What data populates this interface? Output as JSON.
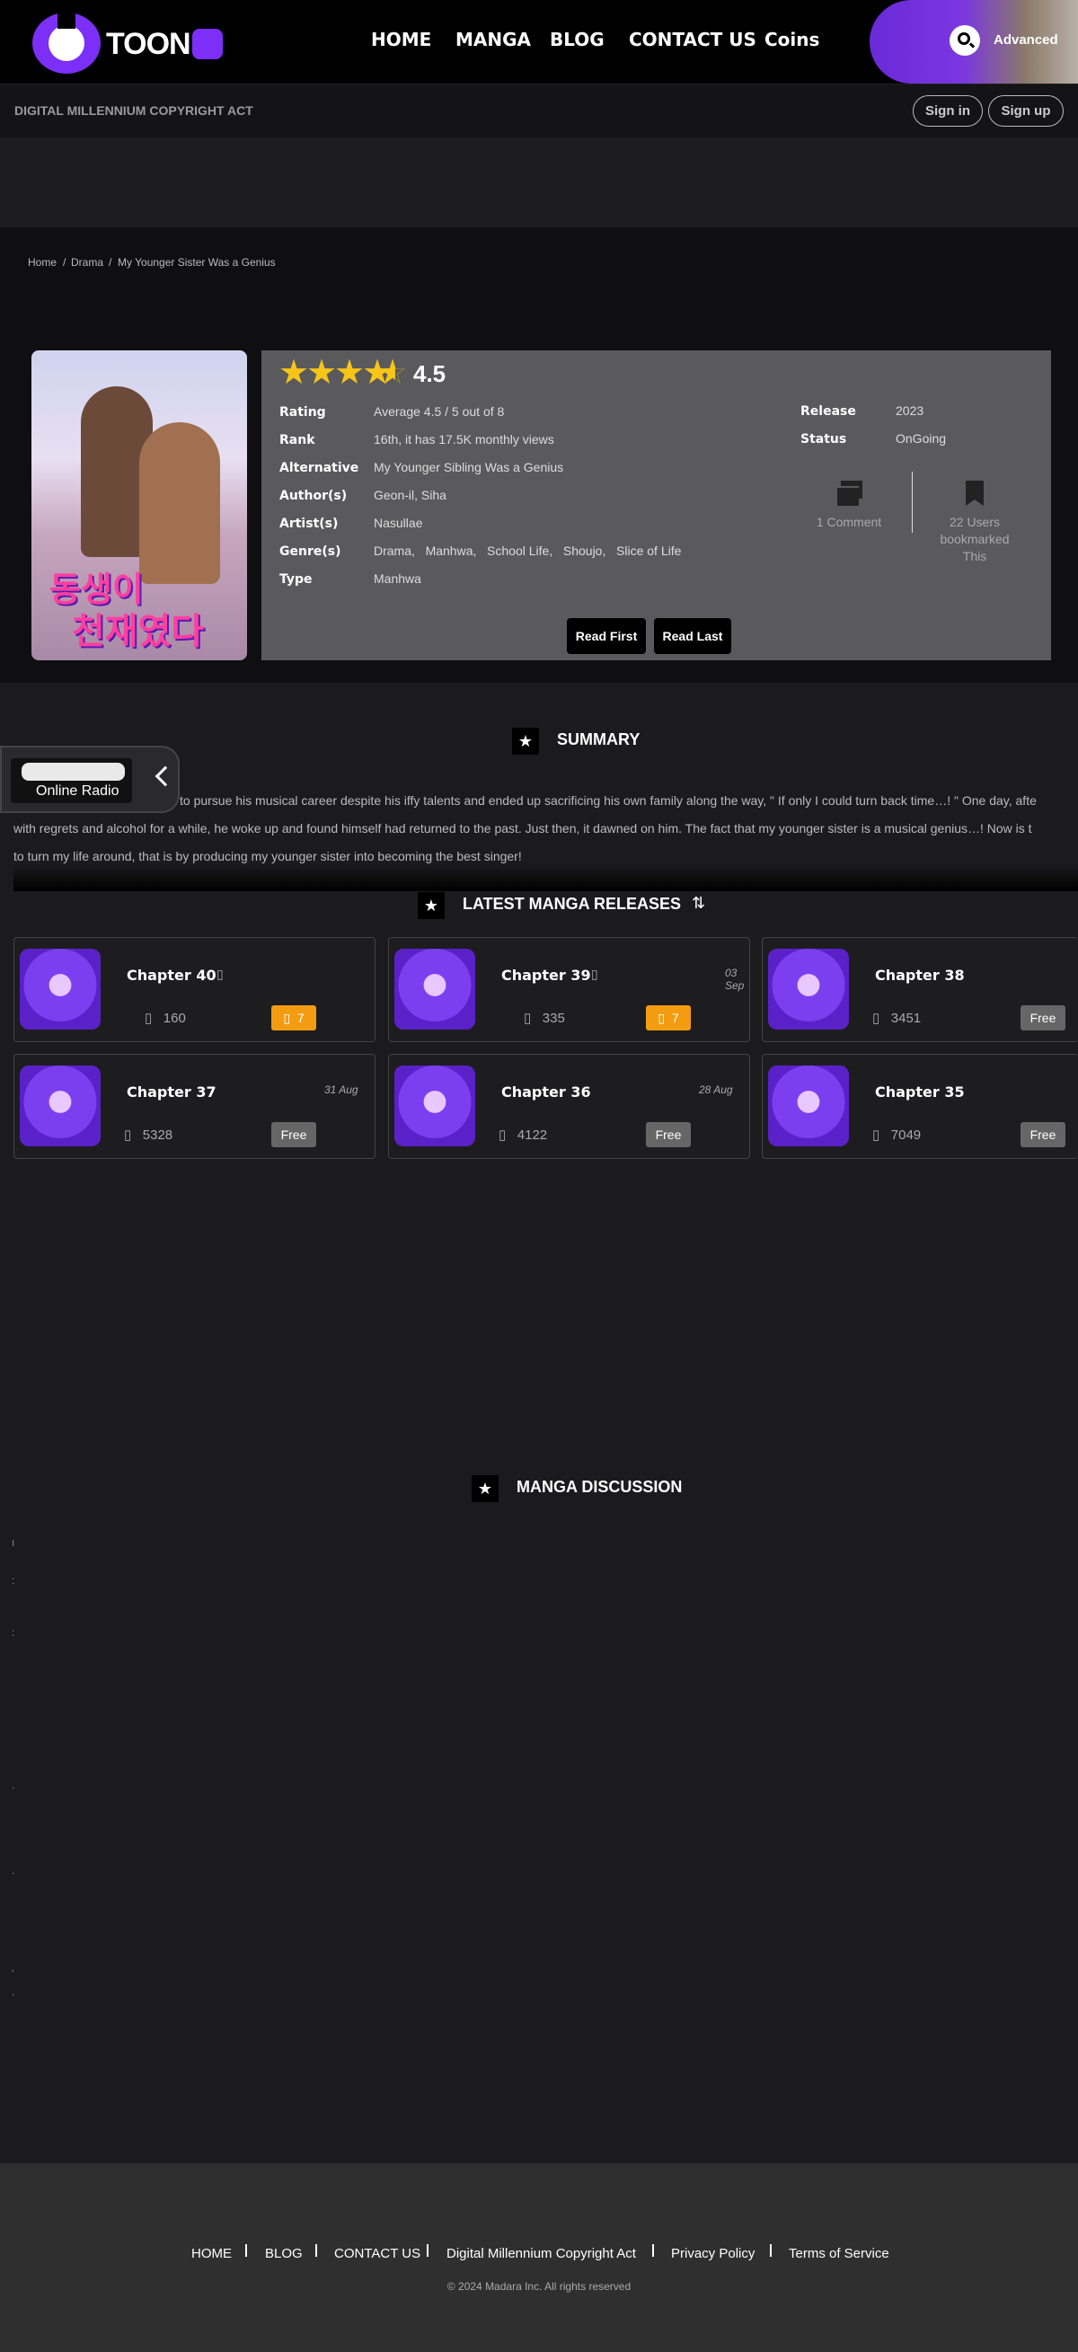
{
  "header": {
    "logo_text": "TOON",
    "nav": [
      "HOME",
      "MANGA",
      "BLOG",
      "CONTACT US",
      "Coins"
    ],
    "advanced_label": "Advanced"
  },
  "subheader": {
    "dmca": "DIGITAL MILLENNIUM COPYRIGHT ACT",
    "sign_in": "Sign in",
    "sign_up": "Sign up"
  },
  "breadcrumb": [
    "Home",
    "Drama",
    "My Younger Sister Was a Genius"
  ],
  "cover": {
    "title_line1": "동생이",
    "title_line2": "천재였다"
  },
  "manga": {
    "score": "4.5",
    "rows": [
      {
        "label": "Rating",
        "value": "Average 4.5 / 5 out of 8"
      },
      {
        "label": "Rank",
        "value": "16th, it has 17.5K monthly views"
      },
      {
        "label": "Alternative",
        "value": "My Younger Sibling Was a Genius"
      },
      {
        "label": "Author(s)",
        "value": "Geon-il,  Siha"
      },
      {
        "label": "Artist(s)",
        "value": "Nasullae"
      },
      {
        "label": "Genre(s)",
        "value": "Drama,   Manhwa,   School Life,   Shoujo,   Slice of Life"
      },
      {
        "label": "Type",
        "value": "Manhwa"
      }
    ],
    "release_label": "Release",
    "release_value": "2023",
    "status_label": "Status",
    "status_value": "OnGoing",
    "comments": "1 Comment",
    "bookmarks_line1": "22 Users",
    "bookmarks_line2": "bookmarked",
    "bookmarks_line3": "This",
    "read_first": "Read First",
    "read_last": "Read Last"
  },
  "summary": {
    "title": "SUMMARY",
    "line1": "to pursue his musical career despite his iffy talents and ended up sacrificing his own family along the way, \" If only I could turn back time…! \" One day, afte",
    "line2": "with regrets and alcohol for a while, he woke up and found himself had returned to the past. Just then, it dawned on him. The fact that my younger sister is a musical genius…! Now is t",
    "line3": "to turn my life around, that is by producing my younger sister into becoming the best singer!"
  },
  "radio": {
    "label": "Online Radio"
  },
  "releases": {
    "title": "LATEST MANGA RELEASES",
    "chapters": [
      {
        "name": "Chapter 40",
        "date": "",
        "views": "160",
        "badge": "7",
        "paid": true
      },
      {
        "name": "Chapter 39",
        "date": "03 Sep",
        "views": "335",
        "badge": "7",
        "paid": true
      },
      {
        "name": "Chapter 38",
        "date": "",
        "views": "3451",
        "badge": "Free",
        "paid": false
      },
      {
        "name": "Chapter 37",
        "date": "31 Aug",
        "views": "5328",
        "badge": "Free",
        "paid": false
      },
      {
        "name": "Chapter 36",
        "date": "28 Aug",
        "views": "4122",
        "badge": "Free",
        "paid": false
      },
      {
        "name": "Chapter 35",
        "date": "",
        "views": "7049",
        "badge": "Free",
        "paid": false
      }
    ]
  },
  "discussion": {
    "title": "MANGA DISCUSSION"
  },
  "footer": {
    "links": [
      "HOME",
      "BLOG",
      "CONTACT US",
      "Digital Millennium Copyright Act",
      "Privacy Policy",
      "Terms of Service"
    ],
    "copyright": "© 2024 Madara Inc. All rights reserved"
  },
  "colors": {
    "accent": "#7b2ff7",
    "coin_badge": "#f39c12",
    "star": "#f5c518"
  }
}
